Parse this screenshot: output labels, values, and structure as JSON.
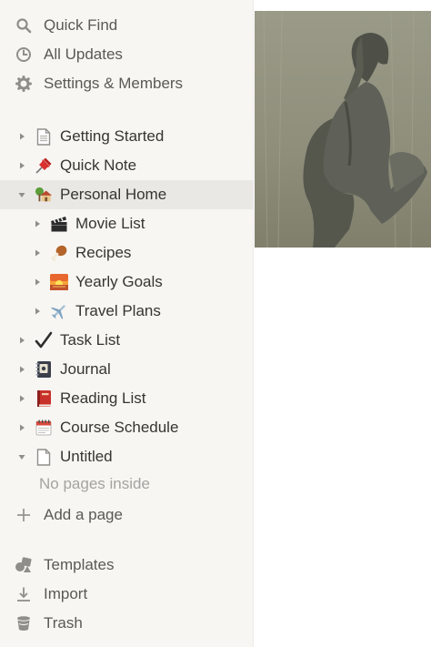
{
  "sidebar": {
    "top": [
      {
        "label": "Quick Find",
        "icon": "search-icon"
      },
      {
        "label": "All Updates",
        "icon": "clock-icon"
      },
      {
        "label": "Settings & Members",
        "icon": "gear-icon"
      }
    ],
    "pages": [
      {
        "label": "Getting Started",
        "icon": "page-icon"
      },
      {
        "label": "Quick Note",
        "icon": "pushpin-icon"
      },
      {
        "label": "Personal Home",
        "icon": "house-icon",
        "expanded": true,
        "selected": true
      },
      {
        "label": "Movie List",
        "icon": "clapper-board-icon"
      },
      {
        "label": "Recipes",
        "icon": "poultry-leg-icon"
      },
      {
        "label": "Yearly Goals",
        "icon": "sunrise-icon"
      },
      {
        "label": "Travel Plans",
        "icon": "airplane-icon"
      },
      {
        "label": "Task List",
        "icon": "check-mark-icon"
      },
      {
        "label": "Journal",
        "icon": "notebook-icon"
      },
      {
        "label": "Reading List",
        "icon": "red-book-icon"
      },
      {
        "label": "Course Schedule",
        "icon": "calendar-icon"
      },
      {
        "label": "Untitled",
        "icon": "page-icon",
        "expanded": true
      }
    ],
    "untitled_empty": "No pages inside",
    "add_page": "Add a page",
    "bottom": [
      {
        "label": "Templates",
        "icon": "templates-icon"
      },
      {
        "label": "Import",
        "icon": "import-icon"
      },
      {
        "label": "Trash",
        "icon": "trash-icon"
      }
    ]
  },
  "colors": {
    "sidebar_bg": "#f7f6f3",
    "selected_bg": "#e9e8e5",
    "text": "#37352f",
    "muted": "#a5a39f"
  }
}
